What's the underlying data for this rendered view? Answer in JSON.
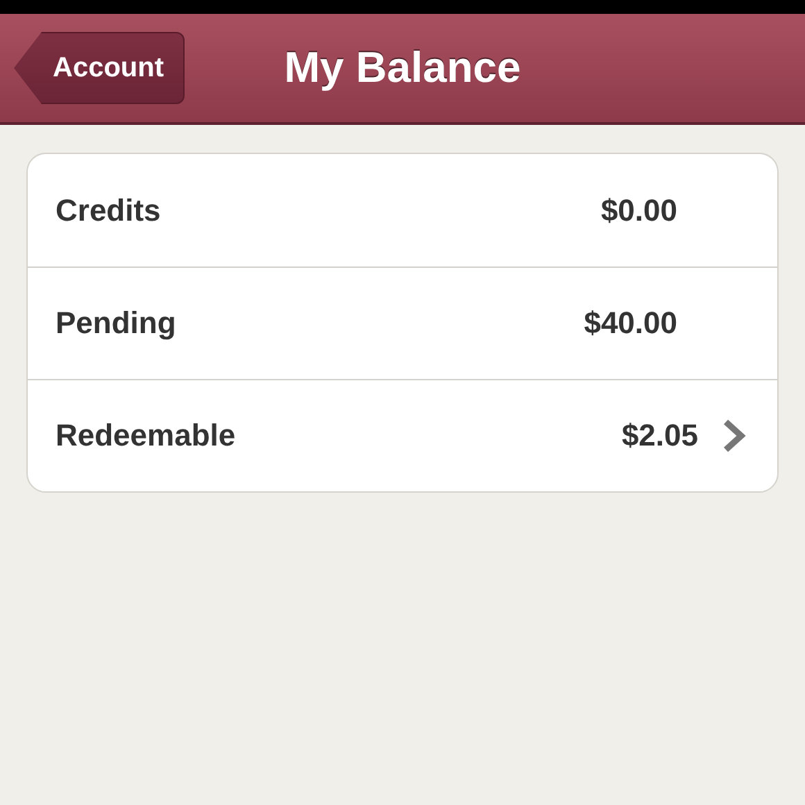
{
  "nav_bar": {
    "back_button": "Account",
    "title": "My Balance"
  },
  "balance_rows": [
    {
      "label": "Credits",
      "value": "$0.00",
      "disclosure": false
    },
    {
      "label": "Pending",
      "value": "$40.00",
      "disclosure": false
    },
    {
      "label": "Redeemable",
      "value": "$2.05",
      "disclosure": true
    }
  ]
}
